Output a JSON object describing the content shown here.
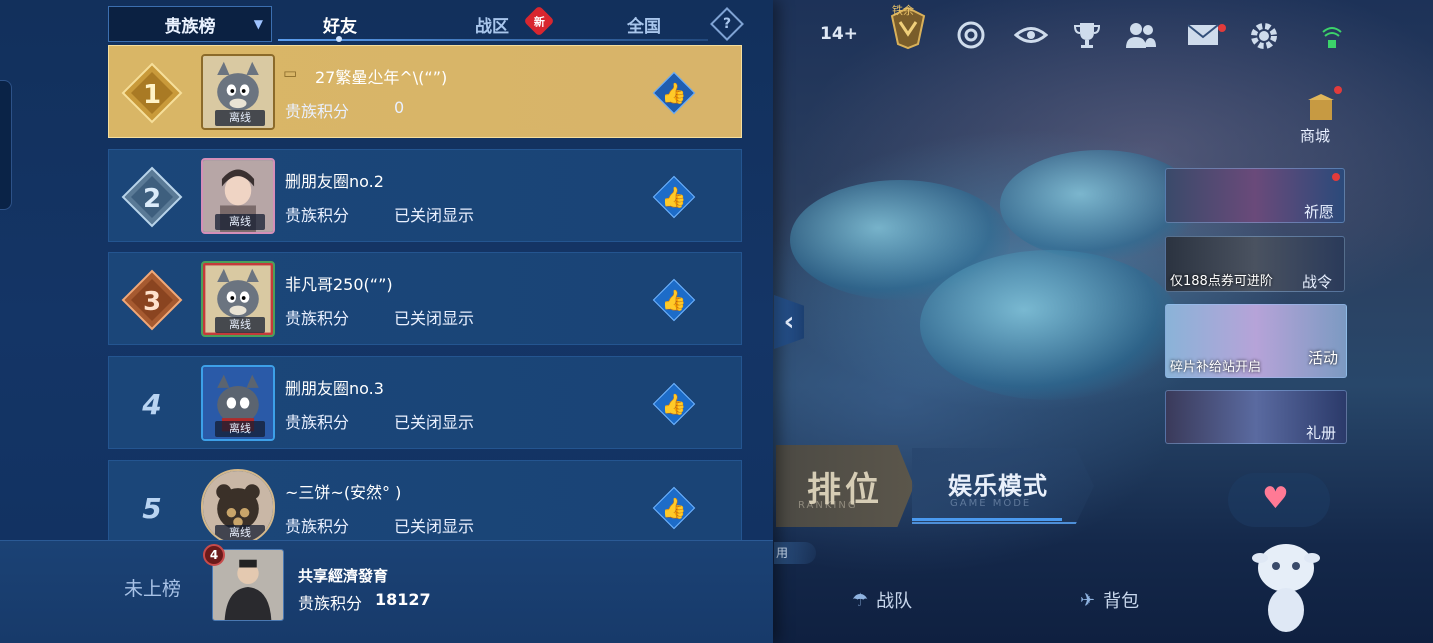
{
  "tabs": {
    "rank_select": "贵族榜",
    "friends": "好友",
    "region": "战区",
    "region_badge": "新",
    "national": "全国",
    "help": "?"
  },
  "leaderboard": [
    {
      "rank": "1",
      "name": "27繁曐尐年^\\(“”)",
      "score_label": "贵族积分",
      "score": "0",
      "status": "离线"
    },
    {
      "rank": "2",
      "name": "删朋友圈no.2",
      "score_label": "贵族积分",
      "score": "已关闭显示",
      "status": "离线"
    },
    {
      "rank": "3",
      "name": "非凡哥250(“”)",
      "score_label": "贵族积分",
      "score": "已关闭显示",
      "status": "离线"
    },
    {
      "rank": "4",
      "name": "删朋友圈no.3",
      "score_label": "贵族积分",
      "score": "已关闭显示",
      "status": "离线"
    },
    {
      "rank": "5",
      "name": "~三饼~(安然° )",
      "score_label": "贵族积分",
      "score": "已关闭显示",
      "status": "离线"
    }
  ],
  "self": {
    "rank_text": "未上榜",
    "level": "4",
    "name": "共享經濟發育",
    "score_label": "贵族积分",
    "score": "18127"
  },
  "topbar": {
    "level_text": "14+",
    "rank_label": "铁余"
  },
  "side": {
    "shop": "商城",
    "wish": "祈愿",
    "pass": "战令",
    "pass_caption": "仅188点券可进阶",
    "event": "活动",
    "event_caption": "碎片补给站开启",
    "gift": "礼册"
  },
  "modes": {
    "ranked": "排位",
    "ranked_sub": "RANKING",
    "fun": "娱乐模式",
    "fun_sub": "GAME MODE",
    "tag": "用"
  },
  "bottom_nav": {
    "team": "战队",
    "bag": "背包"
  },
  "colors": {
    "panel": "#143566",
    "row": "#1b4679",
    "first_row": "#d9b666",
    "accent_blue": "#1d6cc8",
    "red_badge": "#d8262f"
  },
  "icons": [
    "chevron-down-icon",
    "help-icon",
    "thumbs-up-icon",
    "plus-icon",
    "rank-emblem-icon",
    "target-icon",
    "eye-icon",
    "trophy-icon",
    "friends-icon",
    "mail-icon",
    "gear-icon",
    "signal-icon",
    "chevron-left-icon",
    "heart-icon"
  ]
}
